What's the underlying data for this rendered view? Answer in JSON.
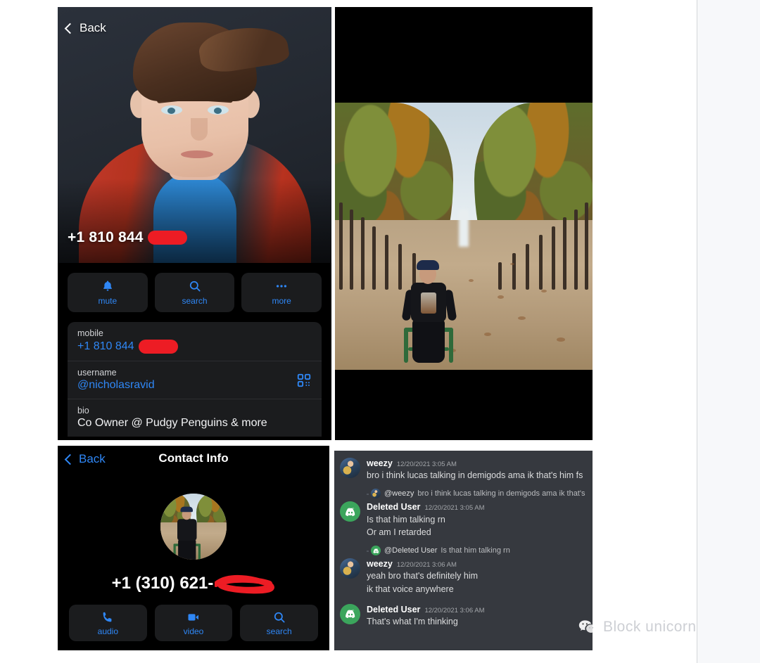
{
  "profile_panel": {
    "back_label": "Back",
    "hero_name": "+1 810 844",
    "actions": [
      {
        "icon": "bell-icon",
        "label": "mute"
      },
      {
        "icon": "search-icon",
        "label": "search"
      },
      {
        "icon": "more-dots-icon",
        "label": "more"
      }
    ],
    "info_rows": [
      {
        "key": "mobile",
        "value": "+1 810 844",
        "redacted": true,
        "trailing_icon": "qr-code-icon"
      },
      {
        "key": "username",
        "value": "@nicholasravid",
        "redacted": false,
        "trailing_icon": "qr-code-icon"
      },
      {
        "key": "bio",
        "value": "Co Owner @ Pudgy Penguins & more",
        "redacted": false,
        "trailing_icon": ""
      }
    ]
  },
  "photo_panel": {
    "alt": "photo of a man seated on a green chair in a tree-lined park path with autumn leaves"
  },
  "contact_panel": {
    "back_label": "Back",
    "title": "Contact Info",
    "phone": "+1 (310) 621-",
    "actions": [
      {
        "icon": "phone-icon",
        "label": "audio"
      },
      {
        "icon": "video-camera-icon",
        "label": "video"
      },
      {
        "icon": "search-icon",
        "label": "search"
      }
    ]
  },
  "discord_panel": {
    "messages": [
      {
        "type": "message",
        "avatar": "weezy",
        "author": "weezy",
        "timestamp": "12/20/2021 3:05 AM",
        "lines": [
          "bro i think lucas talking in demigods ama ik that's him fs"
        ]
      },
      {
        "type": "reply",
        "avatar": "weezy",
        "reply_to": "@weezy",
        "reply_text": "bro i think lucas talking in demigods ama ik that's him fs"
      },
      {
        "type": "message",
        "avatar": "discord",
        "author": "Deleted User",
        "timestamp": "12/20/2021 3:05 AM",
        "lines": [
          "Is that him talking rn",
          "Or am I retarded"
        ]
      },
      {
        "type": "reply",
        "avatar": "discord",
        "reply_to": "@Deleted User",
        "reply_text": "Is that him talking rn"
      },
      {
        "type": "message",
        "avatar": "weezy",
        "author": "weezy",
        "timestamp": "12/20/2021 3:06 AM",
        "lines": [
          "yeah bro that's definitely him",
          "ik that voice anywhere"
        ]
      },
      {
        "type": "message",
        "avatar": "discord",
        "author": "Deleted User",
        "timestamp": "12/20/2021 3:06 AM",
        "lines": [
          "That's what I'm thinking"
        ]
      }
    ]
  },
  "watermark": {
    "text": "Block unicorn",
    "icon": "wechat-icon"
  },
  "colors": {
    "accent_blue": "#2f87f6",
    "redaction_red": "#ed1c24",
    "discord_bg": "#36393f",
    "discord_green": "#3ba55c",
    "panel_surface": "#1b1c1e"
  }
}
